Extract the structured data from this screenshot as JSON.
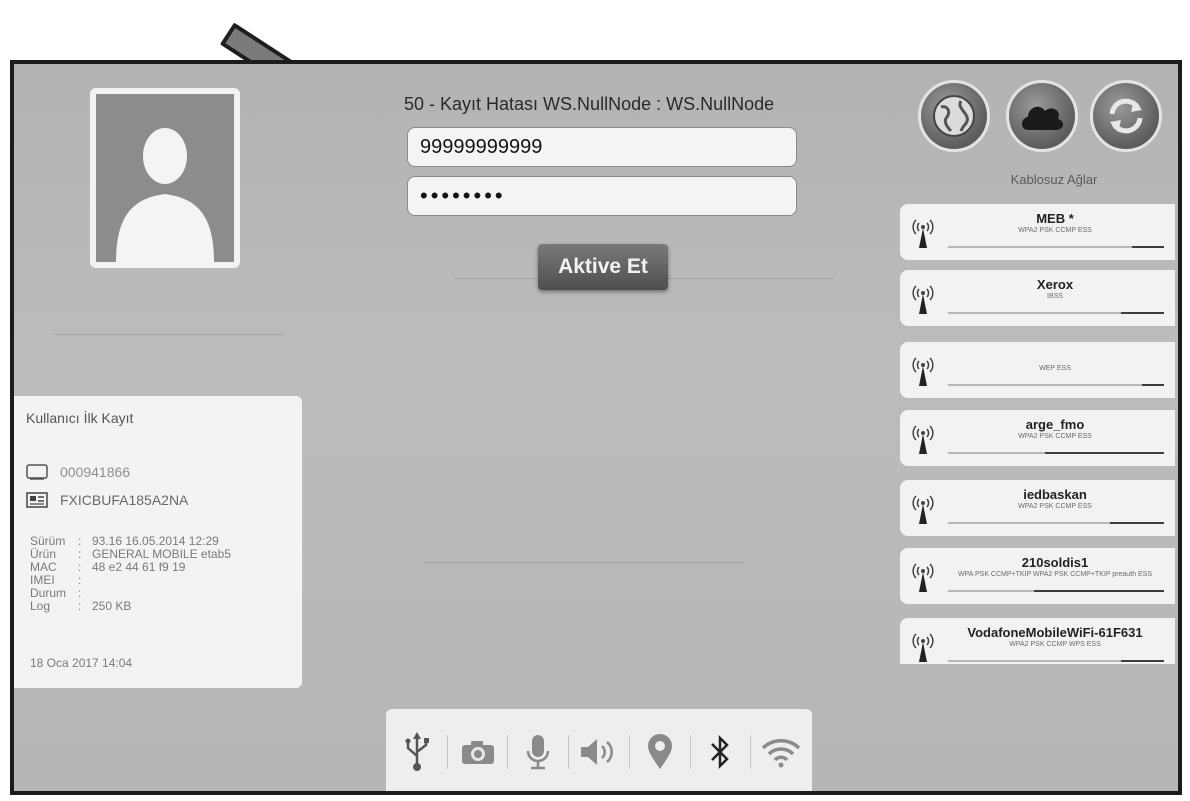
{
  "login": {
    "error_title": "50 - Kayıt Hatası WS.NullNode : WS.NullNode",
    "username_value": "99999999999",
    "password_mask": "••••••••",
    "activate_label": "Aktive Et"
  },
  "top_buttons": [
    "globe-icon",
    "cloud-icon",
    "sync-icon"
  ],
  "wifi": {
    "header": "Kablosuz Ağlar",
    "networks": [
      {
        "name": "MEB *",
        "security": "WPA2 PSK CCMP ESS",
        "signal": 0.15
      },
      {
        "name": "Xerox",
        "security": "IBSS",
        "signal": 0.2
      },
      {
        "name": "",
        "security": "WEP ESS",
        "signal": 0.1
      },
      {
        "name": "arge_fmo",
        "security": "WPA2 PSK CCMP ESS",
        "signal": 0.55
      },
      {
        "name": "iedbaskan",
        "security": "WPA2 PSK CCMP ESS",
        "signal": 0.25
      },
      {
        "name": "210soldis1",
        "security": "WPA PSK CCMP+TKIP WPA2 PSK CCMP+TKIP preauth ESS",
        "signal": 0.6
      },
      {
        "name": "VodafoneMobileWiFi-61F631",
        "security": "WPA2 PSK CCMP WPS ESS",
        "signal": 0.2
      }
    ]
  },
  "info": {
    "title": "Kullanıcı İlk Kayıt",
    "serial": "000941866",
    "code": "FXICBUFA185A2NA",
    "specs": [
      {
        "key": "Sürüm",
        "value": "93.16  16.05.2014 12:29"
      },
      {
        "key": "Ürün",
        "value": "GENERAL MOBILE etab5"
      },
      {
        "key": "MAC",
        "value": "48 e2 44 61 f9 19"
      },
      {
        "key": "IMEI",
        "value": ""
      },
      {
        "key": "Durum",
        "value": ""
      },
      {
        "key": "Log",
        "value": "250 KB"
      }
    ],
    "date": "18 Oca 2017  14:04"
  },
  "status_bar": {
    "icons": [
      "usb-icon",
      "camera-icon",
      "microphone-icon",
      "speaker-icon",
      "location-icon",
      "bluetooth-icon",
      "wifi-icon"
    ]
  },
  "colors": {
    "screen_bg": "#b8b8b8",
    "panel_bg": "#f2f2f2",
    "button_bg": "#5e5e5e",
    "arrow": "#7a7a7a"
  }
}
